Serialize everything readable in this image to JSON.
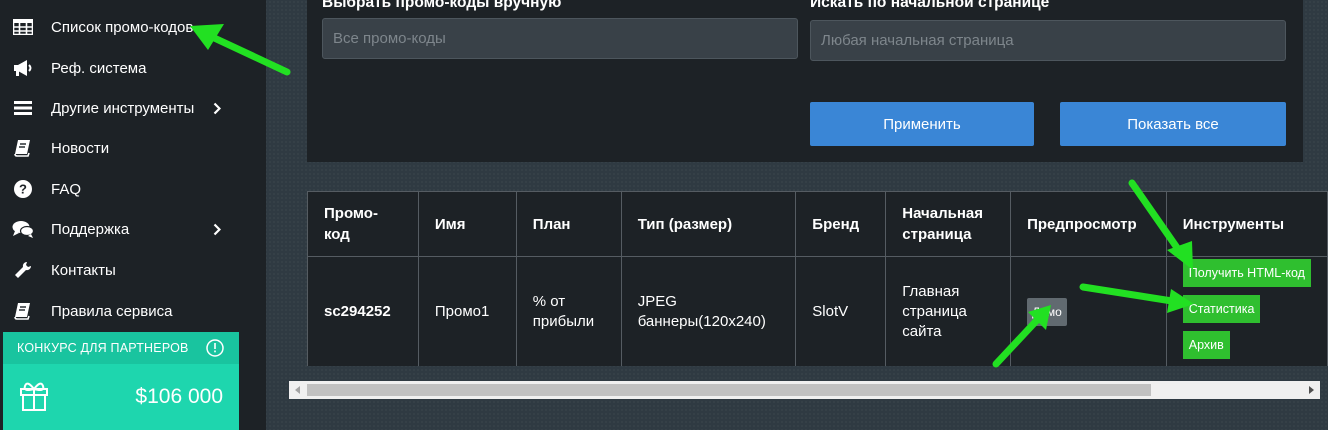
{
  "sidebar": {
    "items": [
      {
        "label": "Список промо-кодов",
        "icon": "table-icon"
      },
      {
        "label": "Реф. система",
        "icon": "megaphone-icon"
      },
      {
        "label": "Другие инструменты",
        "icon": "bars-icon"
      },
      {
        "label": "Новости",
        "icon": "book-icon"
      },
      {
        "label": "FAQ",
        "icon": "question-circle-icon"
      },
      {
        "label": "Поддержка",
        "icon": "comments-icon"
      },
      {
        "label": "Контакты",
        "icon": "wrench-icon"
      },
      {
        "label": "Правила сервиса",
        "icon": "book-icon"
      }
    ],
    "promo": {
      "title": "КОНКУРС ДЛЯ ПАРТНЕРОВ",
      "amount": "$106 000"
    }
  },
  "filters": {
    "manual_label": "Выбрать промо-коды вручную",
    "manual_placeholder": "Все промо-коды",
    "start_label": "Искать по начальной странице",
    "start_placeholder": "Любая начальная страница",
    "apply_label": "Применить",
    "show_all_label": "Показать все"
  },
  "table": {
    "headers": {
      "promo": "Промо-код",
      "name": "Имя",
      "plan": "План",
      "type": "Тип (размер)",
      "brand": "Бренд",
      "start": "Начальная страница",
      "preview": "Предпросмотр",
      "tools": "Инструменты"
    },
    "row": {
      "promo": "sc294252",
      "name": "Промо1",
      "plan": "% от прибыли",
      "type": "JPEG баннеры(120x240)",
      "brand": "SlotV",
      "start": "Главная страница сайта",
      "demo": "Демо",
      "tool_html": "Получить HTML-код",
      "tool_stats": "Статистика",
      "tool_archive": "Архив"
    }
  },
  "colors": {
    "accent_blue": "#3a86d6",
    "promo_teal": "#1ed6ae",
    "tool_green": "#2fbf2f",
    "arrow_green": "#22e022"
  }
}
